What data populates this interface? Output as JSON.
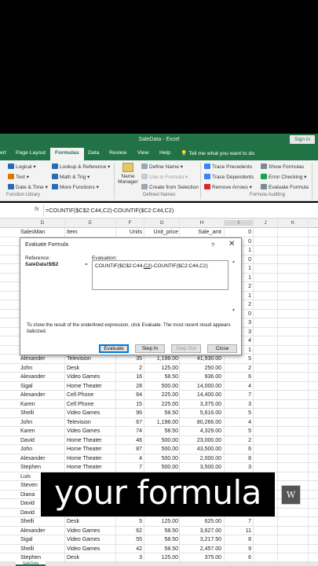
{
  "window": {
    "title": "SaleData - Excel",
    "sign_in": "Sign in"
  },
  "tabs": [
    "ert",
    "Page Layout",
    "Formulas",
    "Data",
    "Review",
    "View",
    "Help"
  ],
  "tell_me": "Tell me what you want to do",
  "ribbon": {
    "function_library": {
      "items": [
        "Logical",
        "Lookup & Reference",
        "Text",
        "Math & Trig",
        "Date & Time",
        "More Functions"
      ],
      "label": "Function Library"
    },
    "defined_names": {
      "name_manager": [
        "Name",
        "Manager"
      ],
      "items": [
        "Define Name",
        "Use in Formula",
        "Create from Selection"
      ],
      "label": "Defined Names"
    },
    "formula_auditing": {
      "items": [
        "Trace Precedents",
        "Show Formulas",
        "Trace Dependents",
        "Error Checking",
        "Remove Arrows",
        "Evaluate Formula"
      ],
      "label": "Formula Auditing"
    },
    "extra": "W\nV"
  },
  "formula_bar": {
    "fx": "fx",
    "formula": "=COUNTIF($C$2:C44,C2)-COUNTIF($C2:C44,C2)"
  },
  "columns": [
    "D",
    "E",
    "F",
    "G",
    "H",
    "I",
    "J",
    "K"
  ],
  "header_row": [
    "SalesMan",
    "Item",
    "Units",
    "Unit_price",
    "Sale_amt"
  ],
  "i_column_top": [
    "0",
    "0",
    "1",
    "0",
    "1",
    "1",
    "2",
    "1",
    "2",
    "0",
    "3",
    "3",
    "4",
    "1"
  ],
  "rows": [
    [
      "Alexander",
      "Television",
      "35",
      "1,198.00",
      "41,930.00",
      "5"
    ],
    [
      "John",
      "Desk",
      "2",
      "125.00",
      "250.00",
      "2"
    ],
    [
      "Alexander",
      "Video Games",
      "16",
      "58.50",
      "936.00",
      "6"
    ],
    [
      "Sigal",
      "Home Theater",
      "28",
      "500.00",
      "14,000.00",
      "4"
    ],
    [
      "Alexander",
      "Cell Phone",
      "64",
      "225.00",
      "14,400.00",
      "7"
    ],
    [
      "Karen",
      "Cell Phone",
      "15",
      "225.00",
      "3,375.00",
      "3"
    ],
    [
      "Shelli",
      "Video Games",
      "96",
      "58.50",
      "5,616.00",
      "5"
    ],
    [
      "John",
      "Television",
      "67",
      "1,198.00",
      "80,266.00",
      "4"
    ],
    [
      "Karen",
      "Video Games",
      "74",
      "58.50",
      "4,329.00",
      "5"
    ],
    [
      "David",
      "Home Theater",
      "46",
      "500.00",
      "23,000.00",
      "2"
    ],
    [
      "John",
      "Home Theater",
      "87",
      "500.00",
      "43,500.00",
      "6"
    ],
    [
      "Alexander",
      "Home Theater",
      "4",
      "500.00",
      "2,000.00",
      "8"
    ],
    [
      "Stephen",
      "Home Theater",
      "7",
      "500.00",
      "3,500.00",
      "3"
    ],
    [
      "Luis",
      "",
      "",
      "",
      "",
      ""
    ],
    [
      "Steven",
      "",
      "",
      "",
      "",
      ""
    ],
    [
      "Diana",
      "",
      "",
      "",
      "",
      ""
    ],
    [
      "David",
      "",
      "",
      "",
      "",
      ""
    ],
    [
      "David",
      "",
      "",
      "",
      "",
      ""
    ],
    [
      "Shelli",
      "Desk",
      "5",
      "125.00",
      "625.00",
      "7"
    ],
    [
      "Alexander",
      "Video Games",
      "62",
      "58.50",
      "3,627.00",
      "11"
    ],
    [
      "Sigal",
      "Video Games",
      "55",
      "58.50",
      "3,217.50",
      "8"
    ],
    [
      "Shelli",
      "Video Games",
      "42",
      "58.50",
      "2,457.00",
      "9"
    ],
    [
      "Stephen",
      "Desk",
      "3",
      "125.00",
      "375.00",
      "6"
    ]
  ],
  "dialog": {
    "title": "Evaluate Formula",
    "help": "?",
    "close": "✕",
    "reference_label": "Reference:",
    "reference_value": "SaleData!$I$2",
    "equals": "=",
    "evaluation_label": "Evaluation:",
    "evaluation_pre": "COUNTIF($C$2:C44,",
    "evaluation_underlined": "C2",
    "evaluation_post": ")-COUNTIF($C2:C44,C2)",
    "hint": "To show the result of the underlined expression, click Evaluate.  The most recent result appears italicized.",
    "buttons": {
      "evaluate": "Evaluate",
      "step_in": "Step In",
      "step_out": "Step Out",
      "close": "Close"
    }
  },
  "caption": "your formula",
  "logo": "W",
  "sheet_tab": "SaleData"
}
